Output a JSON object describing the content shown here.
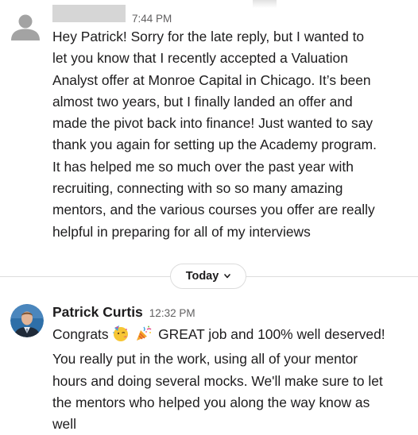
{
  "messages": [
    {
      "sender": "",
      "time": "7:44 PM",
      "lines": [
        "Hey Patrick! Sorry for the late reply, but I wanted to",
        "let you know that I recently accepted a Valuation",
        "Analyst offer at Monroe Capital in Chicago. It’s been",
        "almost two years, but I finally landed an offer and",
        "made the pivot back into finance! Just wanted to say",
        "thank you again for setting up the Academy program.",
        "It has helped me so much over the past year with",
        "recruiting, connecting with so so many amazing",
        "mentors, and the various courses you offer are really",
        "helpful in preparing for all of my interviews"
      ]
    },
    {
      "sender": "Patrick Curtis",
      "time": "12:32 PM",
      "first_line_prefix": "Congrats",
      "emojis": [
        "partying-face-emoji",
        "party-popper-emoji"
      ],
      "first_line_suffix": "GREAT job and 100% well deserved!",
      "lines": [
        "You really put in the work, using all of your mentor",
        "hours and doing several mocks. We'll make sure to let",
        "the mentors who helped you along the way know as",
        "well"
      ]
    }
  ],
  "divider": {
    "label": "Today",
    "icon": "chevron-down-icon"
  },
  "colors": {
    "text": "#1d1c1d",
    "muted": "#616061",
    "divider": "#dddddd",
    "redaction": "#d6d6d6"
  }
}
